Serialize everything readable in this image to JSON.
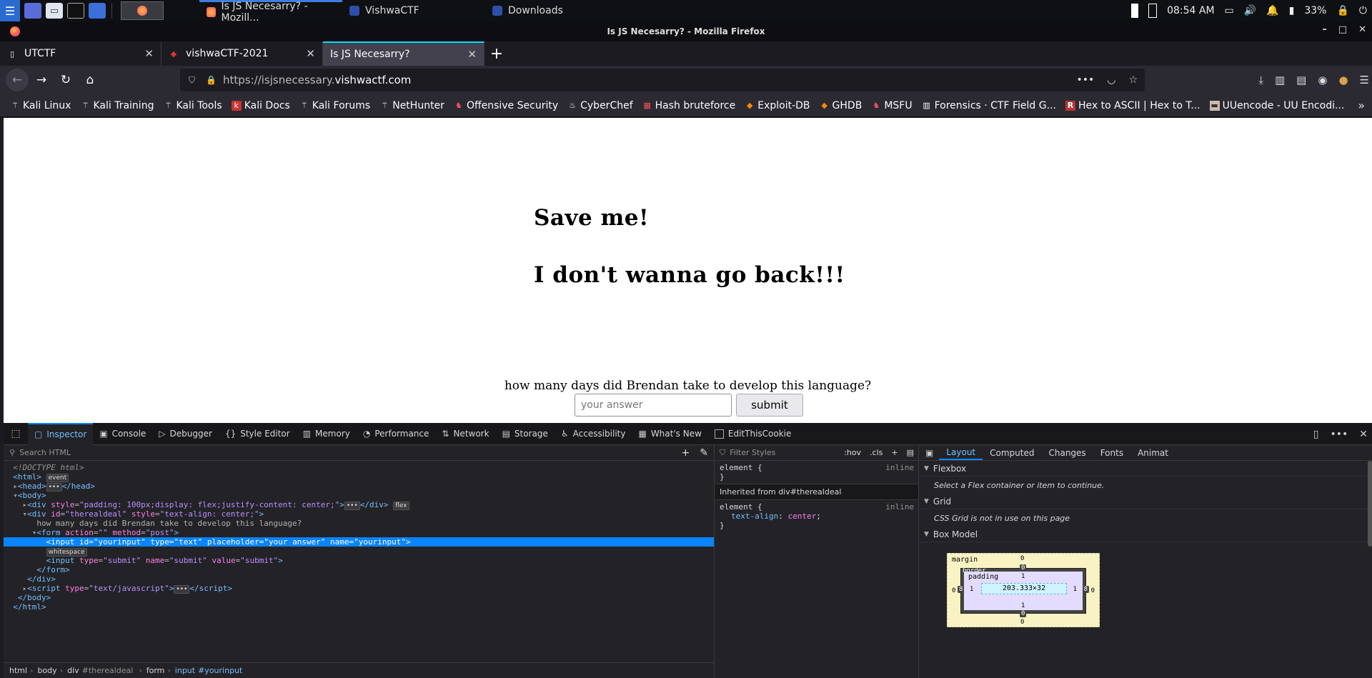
{
  "taskbar": {
    "tasks": [
      {
        "label": "Is JS Necesarry? - Mozill...",
        "active": true
      },
      {
        "label": "VishwaCTF",
        "active": false
      },
      {
        "label": "Downloads",
        "active": false
      }
    ],
    "time": "08:54 AM",
    "battery": "33%"
  },
  "window": {
    "title": "Is JS Necesarry? - Mozilla Firefox"
  },
  "tabs": [
    {
      "label": "UTCTF",
      "active": false
    },
    {
      "label": "vishwaCTF-2021",
      "active": false
    },
    {
      "label": "Is JS Necesarry?",
      "active": true
    }
  ],
  "navbar": {
    "url_prefix": "https://isjsnecessary.",
    "url_host": "vishwactf.com"
  },
  "bookmarks": [
    "Kali Linux",
    "Kali Training",
    "Kali Tools",
    "Kali Docs",
    "Kali Forums",
    "NetHunter",
    "Offensive Security",
    "CyberChef",
    "Hash bruteforce",
    "Exploit-DB",
    "GHDB",
    "MSFU",
    "Forensics · CTF Field G...",
    "Hex to ASCII | Hex to T...",
    "UUencode - UU Encodi..."
  ],
  "page": {
    "heading1": "Save me!",
    "heading2": "I don't wanna go back!!!",
    "question": "how many days did Brendan take to develop this language?",
    "input_placeholder": "your answer",
    "submit_label": "submit"
  },
  "devtools": {
    "tabs": [
      {
        "label": "Inspector",
        "icon": "inspector-icon",
        "glyph": "▢",
        "active": true
      },
      {
        "label": "Console",
        "icon": "console-icon",
        "glyph": "▣",
        "active": false
      },
      {
        "label": "Debugger",
        "icon": "debugger-icon",
        "glyph": "▷",
        "active": false
      },
      {
        "label": "Style Editor",
        "icon": "braces-icon",
        "glyph": "{}",
        "active": false
      },
      {
        "label": "Memory",
        "icon": "memory-icon",
        "glyph": "▥",
        "active": false
      },
      {
        "label": "Performance",
        "icon": "gauge-icon",
        "glyph": "◔",
        "active": false
      },
      {
        "label": "Network",
        "icon": "network-icon",
        "glyph": "⇅",
        "active": false
      },
      {
        "label": "Storage",
        "icon": "storage-icon",
        "glyph": "▤",
        "active": false
      },
      {
        "label": "Accessibility",
        "icon": "accessibility-icon",
        "glyph": "♿",
        "active": false
      },
      {
        "label": "What's New",
        "icon": "gift-icon",
        "glyph": "▦",
        "active": false
      }
    ],
    "extension_tab": "EditThisCookie",
    "search_placeholder": "Search HTML",
    "filter_placeholder": "Filter Styles",
    "hov": ":hov",
    "cls": ".cls",
    "breadcrumbs": [
      "html",
      "body",
      "div",
      "#therealdeal",
      "form",
      "input",
      "#yourinput"
    ],
    "rules": {
      "element1": "element {",
      "inline1": "inline",
      "close1": "}",
      "inherited": "Inherited from div#therealdeal",
      "element2": "element {",
      "inline2": "inline",
      "prop": "text-align",
      "val": "center",
      "close2": "}"
    },
    "layout_tabs": [
      "Layout",
      "Computed",
      "Changes",
      "Fonts",
      "Animat"
    ],
    "flexbox_title": "Flexbox",
    "flexbox_note": "Select a Flex container or item to continue.",
    "grid_title": "Grid",
    "grid_note": "CSS Grid is not in use on this page",
    "boxmodel_title": "Box Model",
    "boxmodel": {
      "margin_label": "margin",
      "border_label": "border",
      "padding_label": "padding",
      "content": "203.333×32",
      "margin_top": "0",
      "margin_bottom": "0",
      "margin_left": "0",
      "margin_right": "0",
      "border_top": "0",
      "border_bottom": "0",
      "border_left": "8",
      "border_right": "8",
      "padding_top": "1",
      "padding_bottom": "1",
      "padding_left": "1",
      "padding_right": "1"
    }
  }
}
